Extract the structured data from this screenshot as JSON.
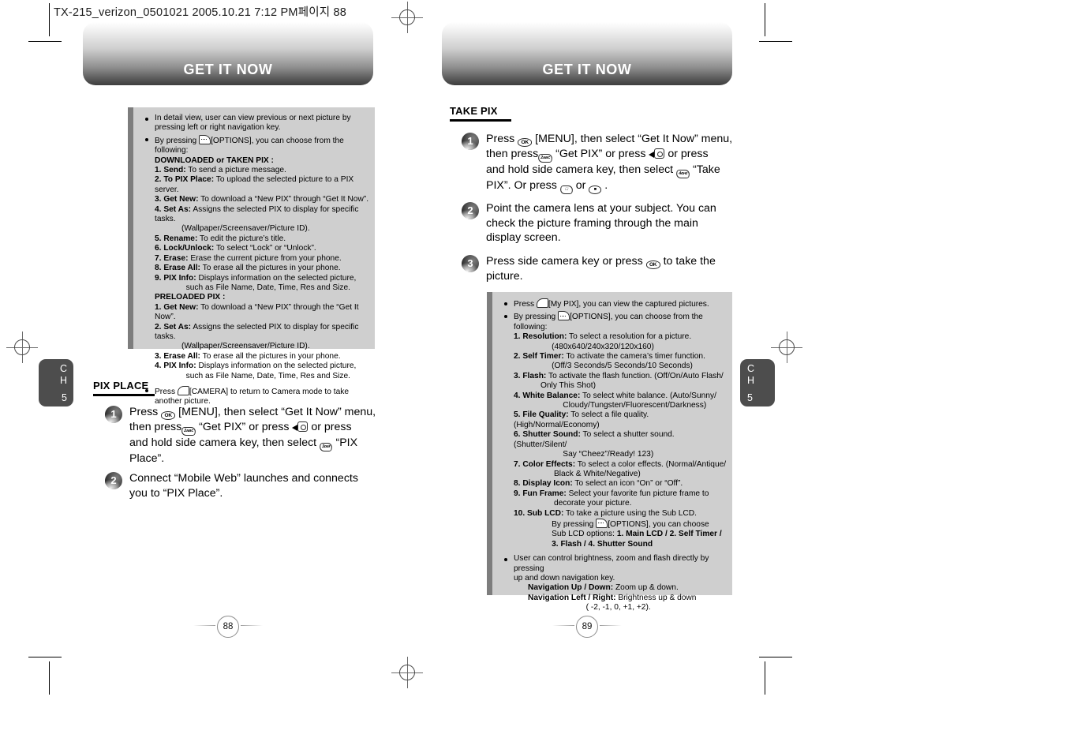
{
  "slug": "TX-215_verizon_0501021  2005.10.21  7:12 PM페이지 88",
  "left_page": {
    "chapter_title": "GET IT NOW",
    "chapter_tab": {
      "ch": "C",
      "h": "H",
      "num": "5"
    },
    "folio": "88",
    "gray_box": {
      "blocks": [
        {
          "bullet": true,
          "lines": [
            "In detail view, user can view previous or next picture by",
            "pressing left or right navigation key."
          ]
        },
        {
          "bullet": true,
          "lines": [
            "By pressing  [OPTIONS], you can choose from the following:"
          ]
        }
      ],
      "downloaded_heading": "DOWNLOADED or TAKEN PIX :",
      "downloaded_items": [
        {
          "label": "1. Send:",
          "text": " To send a picture message."
        },
        {
          "label": "2. To PIX Place:",
          "text": " To upload the selected picture to a PIX server."
        },
        {
          "label": "3. Get New:",
          "text": " To download a “New PIX” through “Get It Now”."
        },
        {
          "label": "4. Set As:",
          "text": " Assigns the selected PIX to display for specific tasks."
        },
        {
          "label": "",
          "text": "            (Wallpaper/Screensaver/Picture ID)."
        },
        {
          "label": "5. Rename:",
          "text": " To edit the picture’s title."
        },
        {
          "label": "6. Lock/Unlock:",
          "text": " To select “Lock” or “Unlock”."
        },
        {
          "label": "7. Erase:",
          "text": " Erase the current picture from your phone."
        },
        {
          "label": "8. Erase All:",
          "text": " To erase all the pictures in your phone."
        },
        {
          "label": "9. PIX Info:",
          "text": " Displays information on the selected picture,"
        },
        {
          "label": "",
          "text": "              such as File Name, Date, Time, Res and Size."
        }
      ],
      "preloaded_heading": "PRELOADED PIX :",
      "preloaded_items": [
        {
          "label": "1. Get New:",
          "text": " To download a “New PIX” through the “Get It Now”."
        },
        {
          "label": "2. Set As:",
          "text": " Assigns the selected PIX to display for specific tasks."
        },
        {
          "label": "",
          "text": "            (Wallpaper/Screensaver/Picture ID)."
        },
        {
          "label": "3. Erase All:",
          "text": " To erase all the pictures in your phone."
        },
        {
          "label": "4. PIX Info:",
          "text": " Displays information on the selected picture,"
        },
        {
          "label": "",
          "text": "              such as File Name, Date, Time, Res and Size."
        }
      ],
      "last_bullet": {
        "lines": [
          "Press  [CAMERA] to return to Camera mode to take",
          "another picture."
        ]
      }
    },
    "section": {
      "title": "PIX PLACE"
    },
    "steps": [
      {
        "num": "1",
        "segments": [
          {
            "t": "text",
            "v": "Press "
          },
          {
            "t": "key",
            "v": "OK"
          },
          {
            "t": "text",
            "v": " [MENU], then select “Get It Now” menu,"
          },
          {
            "t": "br"
          },
          {
            "t": "text",
            "v": "then press"
          },
          {
            "t": "key-skew",
            "v": "2ᴀʙᴄ"
          },
          {
            "t": "text",
            "v": " “Get PIX” or press "
          },
          {
            "t": "arrow-left"
          },
          {
            "t": "nav-pad"
          },
          {
            "t": "text",
            "v": " or press"
          },
          {
            "t": "br"
          },
          {
            "t": "text",
            "v": "and hold side camera key, then select "
          },
          {
            "t": "key-skew",
            "v": "3ᴅᴇғ"
          },
          {
            "t": "text",
            "v": " “PIX"
          },
          {
            "t": "br"
          },
          {
            "t": "text",
            "v": "Place”."
          }
        ]
      },
      {
        "num": "2",
        "segments": [
          {
            "t": "text",
            "v": "Connect “Mobile Web” launches and connects"
          },
          {
            "t": "br"
          },
          {
            "t": "text",
            "v": "you to “PIX Place”."
          }
        ]
      }
    ]
  },
  "right_page": {
    "chapter_title": "GET IT NOW",
    "chapter_tab": {
      "ch": "C",
      "h": "H",
      "num": "5"
    },
    "folio": "89",
    "section": {
      "title": "TAKE PIX"
    },
    "steps": [
      {
        "num": "1",
        "segments": [
          {
            "t": "text",
            "v": "Press "
          },
          {
            "t": "key",
            "v": "OK"
          },
          {
            "t": "text",
            "v": " [MENU], then select “Get It Now” menu,"
          },
          {
            "t": "br"
          },
          {
            "t": "text",
            "v": "then press"
          },
          {
            "t": "key-skew",
            "v": "2ᴀʙᴄ"
          },
          {
            "t": "text",
            "v": " “Get PIX” or press "
          },
          {
            "t": "arrow-left"
          },
          {
            "t": "nav-pad"
          },
          {
            "t": "text",
            "v": " or press"
          },
          {
            "t": "br"
          },
          {
            "t": "text",
            "v": "and hold side camera key, then select "
          },
          {
            "t": "key-skew",
            "v": "4ɢʜɪ"
          },
          {
            "t": "text",
            "v": " “Take"
          },
          {
            "t": "br"
          },
          {
            "t": "text",
            "v": "PIX”. Or press "
          },
          {
            "t": "key-skew",
            "v": "□"
          },
          {
            "t": "text",
            "v": " or "
          },
          {
            "t": "key-round",
            "v": "■"
          },
          {
            "t": "text",
            "v": " ."
          }
        ]
      },
      {
        "num": "2",
        "segments": [
          {
            "t": "text",
            "v": "Point the camera lens at your subject. You can"
          },
          {
            "t": "br"
          },
          {
            "t": "text",
            "v": "check the picture framing through the main"
          },
          {
            "t": "br"
          },
          {
            "t": "text",
            "v": "display screen."
          }
        ]
      },
      {
        "num": "3",
        "segments": [
          {
            "t": "text",
            "v": "Press side camera key or press "
          },
          {
            "t": "key",
            "v": "OK"
          },
          {
            "t": "text",
            "v": " to take the"
          },
          {
            "t": "br"
          },
          {
            "t": "text",
            "v": "picture."
          }
        ]
      }
    ],
    "gray_box": {
      "bullet_press": "Press  [My PIX], you can view the captured pictures.",
      "bullet_options": "By pressing  [OPTIONS], you can choose from the following:",
      "options": [
        {
          "label": "1. Resolution:",
          "text": " To select a resolution for a picture."
        },
        {
          "label": "",
          "text": "                 (480x640/240x320/120x160)"
        },
        {
          "label": "2. Self Timer:",
          "text": " To activate the camera’s timer function."
        },
        {
          "label": "",
          "text": "                 (Off/3 Seconds/5 Seconds/10 Seconds)"
        },
        {
          "label": "3. Flash:",
          "text": " To activate the flash function. (Off/On/Auto Flash/"
        },
        {
          "label": "",
          "text": "            Only This Shot)"
        },
        {
          "label": "4. White Balance:",
          "text": " To select white balance. (Auto/Sunny/"
        },
        {
          "label": "",
          "text": "                      Cloudy/Tungsten/Fluorescent/Darkness)"
        },
        {
          "label": "5. File Quality:",
          "text": " To select a file quality.(High/Normal/Economy)"
        },
        {
          "label": "6. Shutter Sound:",
          "text": " To select a shutter sound. (Shutter/Silent/"
        },
        {
          "label": "",
          "text": "                      Say “Cheez”/Ready! 123)"
        },
        {
          "label": "7. Color Effects:",
          "text": " To select a color effects. (Normal/Antique/"
        },
        {
          "label": "",
          "text": "                  Black & White/Negative)"
        },
        {
          "label": "8. Display Icon:",
          "text": " To select an icon “On” or “Off”."
        },
        {
          "label": "9. Fun Frame:",
          "text": " Select your favorite fun picture frame to"
        },
        {
          "label": "",
          "text": "                  decorate your picture."
        },
        {
          "label": "10. Sub LCD:",
          "text": " To take a picture using the Sub LCD."
        }
      ],
      "sublcd_lines": [
        "                 By pressing  [OPTIONS], you can choose",
        "                 Sub LCD options: "
      ],
      "sublcd_bold_a": "1. Main LCD / 2. Self Timer /",
      "sublcd_bold_b": "                 3. Flash / 4. Shutter Sound",
      "bullet_nav": {
        "lines": [
          "User can control brightness, zoom and flash directly by pressing",
          "up and down navigation key."
        ]
      },
      "nav_items": [
        {
          "label": "Navigation Up / Down:",
          "text": " Zoom up & down."
        },
        {
          "label": "Navigation Left / Right:",
          "text": " Brightness up & down"
        },
        {
          "label": "",
          "text": "                          ( -2, -1, 0, +1, +2)."
        }
      ]
    }
  }
}
